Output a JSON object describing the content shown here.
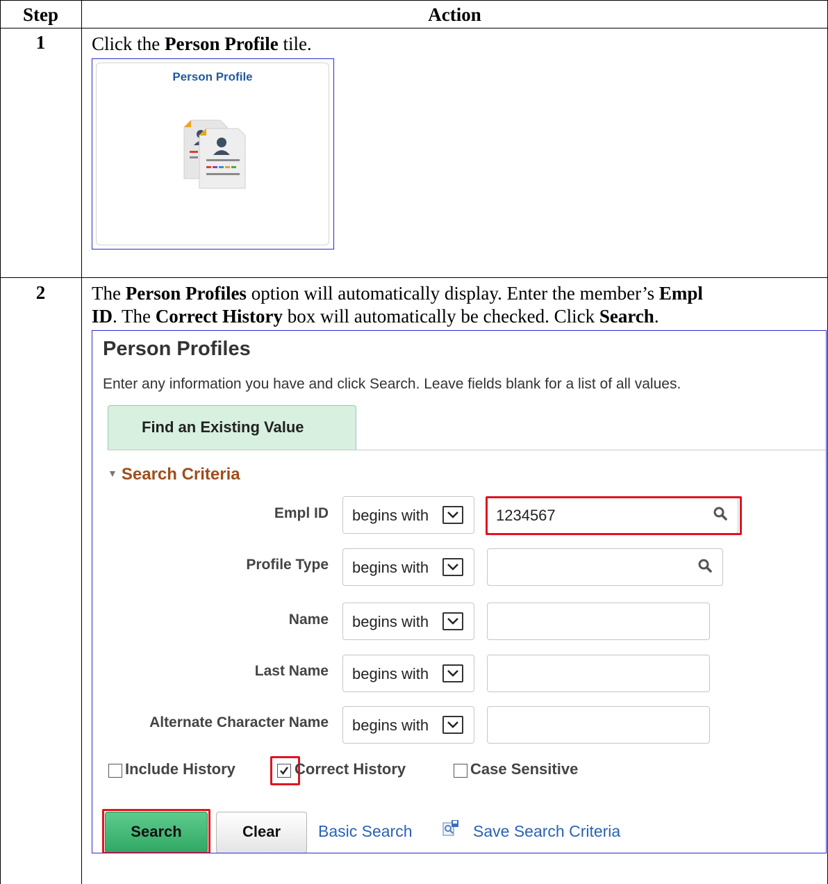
{
  "table": {
    "header_step": "Step",
    "header_action": "Action"
  },
  "steps": [
    {
      "number": "1",
      "text_pre": "Click the ",
      "text_bold": "Person Profile",
      "text_post": " tile.",
      "tile_title": "Person Profile"
    },
    {
      "number": "2",
      "line1_pre": "The ",
      "line1_bold1": "Person Profiles",
      "line1_mid": " option will automatically display. Enter the member’s ",
      "line1_bold2": "Empl",
      "line2_bold1": "ID",
      "line2_mid": ".  The ",
      "line2_bold2": "Correct History",
      "line2_mid2": " box will automatically be checked.  Click ",
      "line2_bold3": "Search",
      "line2_post": "."
    }
  ],
  "panel": {
    "title": "Person Profiles",
    "instructions": "Enter any information you have and click Search. Leave fields blank for a list of all values.",
    "tab_label": "Find an Existing Value",
    "section_label": "Search Criteria",
    "fields": [
      {
        "label": "Empl ID",
        "operator": "begins with",
        "value": "1234567",
        "has_lookup": true,
        "highlighted": true
      },
      {
        "label": "Profile Type",
        "operator": "begins with",
        "value": "",
        "has_lookup": true,
        "highlighted": false
      },
      {
        "label": "Name",
        "operator": "begins with",
        "value": "",
        "has_lookup": false,
        "highlighted": false
      },
      {
        "label": "Last Name",
        "operator": "begins with",
        "value": "",
        "has_lookup": false,
        "highlighted": false
      },
      {
        "label": "Alternate Character Name",
        "operator": "begins with",
        "value": "",
        "has_lookup": false,
        "highlighted": false
      }
    ],
    "checkboxes": [
      {
        "label": "Include History",
        "checked": false
      },
      {
        "label": "Correct History",
        "checked": true
      },
      {
        "label": "Case Sensitive",
        "checked": false
      }
    ],
    "search_button": "Search",
    "clear_button": "Clear",
    "basic_search_link": "Basic Search",
    "save_search_link": "Save Search Criteria"
  },
  "colors": {
    "highlight": "#e0141e",
    "tab_bg": "#d8f0e0",
    "section_header": "#a04d1a",
    "link": "#2a62b8",
    "search_button": "#3fb872"
  },
  "icons": [
    "person-profile-tile-icon",
    "search-lookup-icon",
    "dropdown-chevron-icon",
    "checkmark-icon",
    "save-search-icon",
    "collapse-triangle-icon"
  ]
}
